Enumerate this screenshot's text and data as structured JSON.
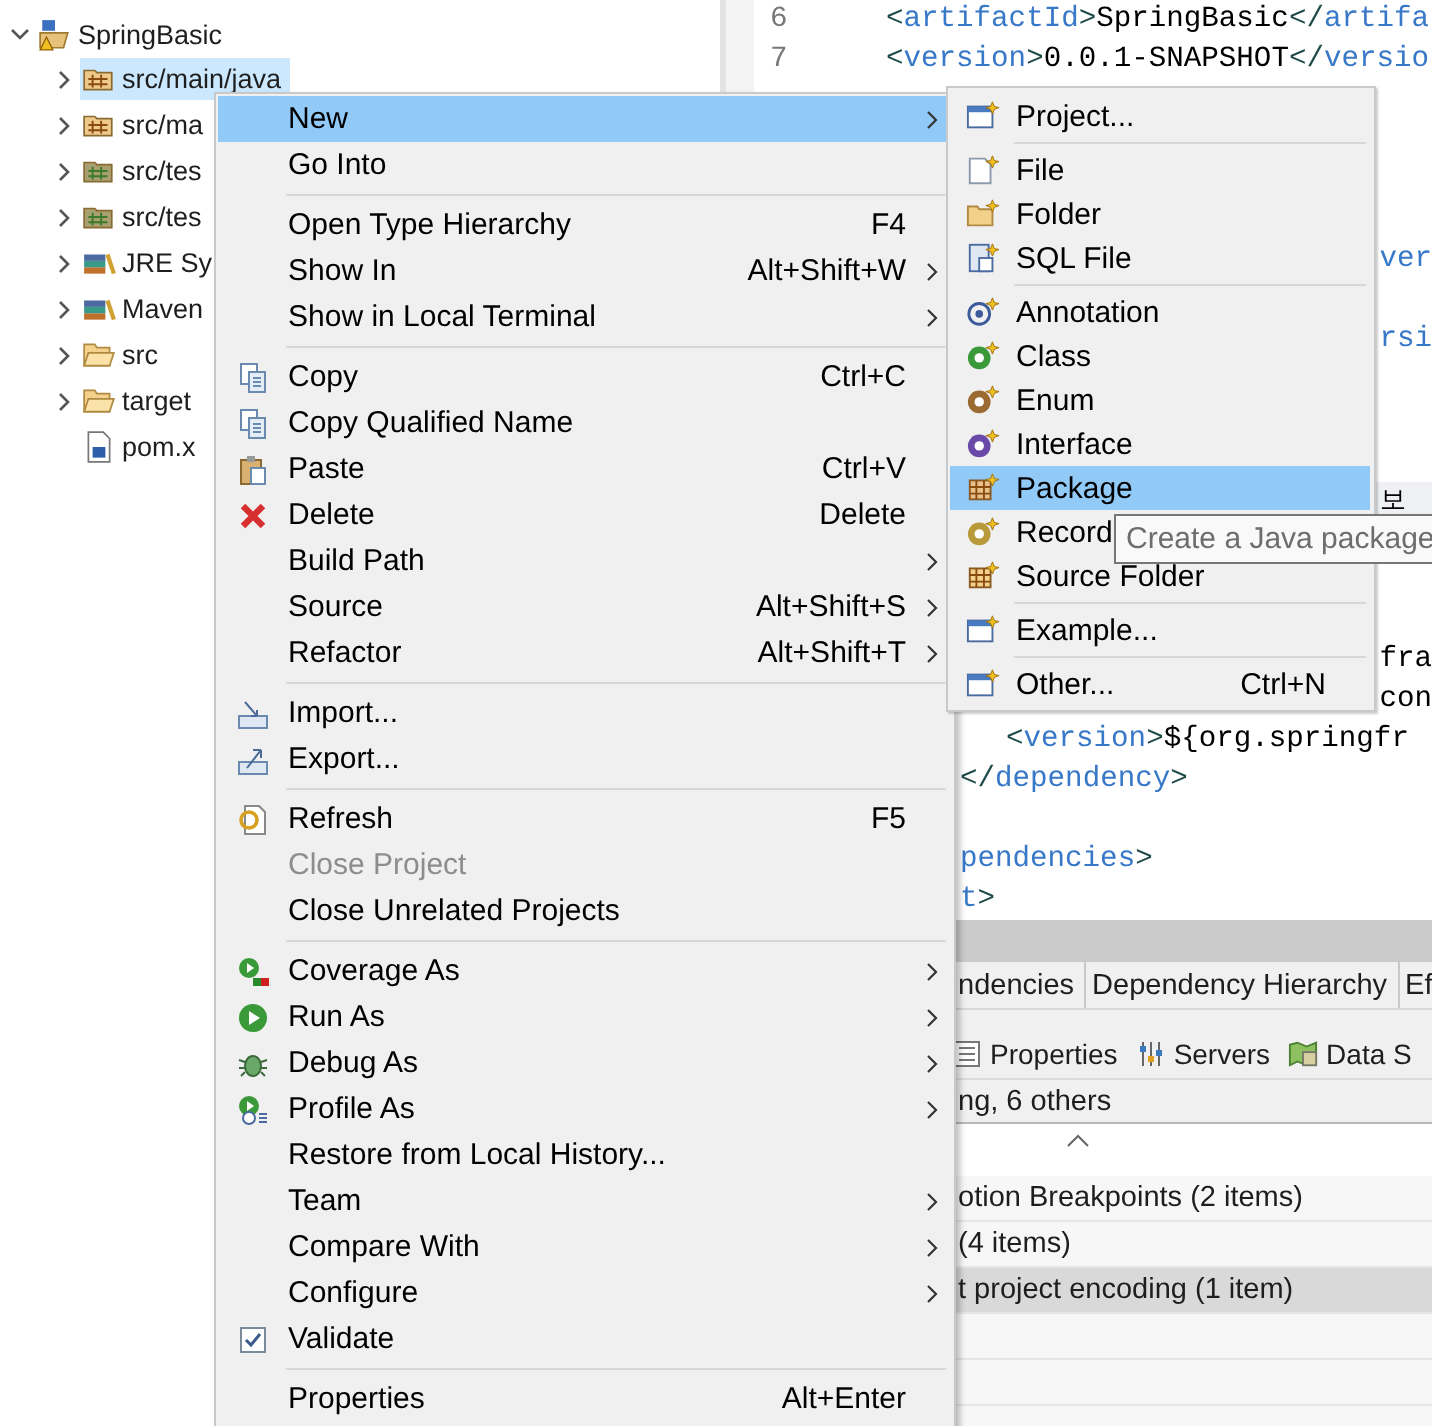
{
  "explorer": {
    "tree": [
      {
        "label": "SpringBasic",
        "kind": "project",
        "expanded": true,
        "selected": false,
        "warning": true,
        "children": [
          {
            "label": "src/main/java",
            "kind": "source-folder",
            "expanded": false,
            "selected": true
          },
          {
            "label": "src/ma",
            "kind": "source-folder",
            "expanded": false,
            "selected": false
          },
          {
            "label": "src/tes",
            "kind": "test-folder",
            "expanded": false,
            "selected": false
          },
          {
            "label": "src/tes",
            "kind": "test-folder",
            "expanded": false,
            "selected": false
          },
          {
            "label": "JRE Sy",
            "kind": "library",
            "expanded": false,
            "selected": false
          },
          {
            "label": "Maven",
            "kind": "library",
            "expanded": false,
            "selected": false
          },
          {
            "label": "src",
            "kind": "folder",
            "expanded": false,
            "selected": false
          },
          {
            "label": "target",
            "kind": "folder",
            "expanded": false,
            "selected": false
          },
          {
            "label": "pom.x",
            "kind": "file",
            "selected": false
          }
        ]
      }
    ]
  },
  "editor": {
    "lines": [
      {
        "number": "6",
        "kind": "code",
        "text": "<artifactId>SpringBasic</artifa"
      },
      {
        "number": "7",
        "kind": "code",
        "text": "<version>0.0.1-SNAPSHOT</versio"
      },
      {
        "kind": "blank"
      },
      {
        "kind": "blank"
      },
      {
        "kind": "blank"
      },
      {
        "kind": "blank"
      },
      {
        "kind": "fragment-right",
        "text": "ver",
        "in_tag": true
      },
      {
        "kind": "blank"
      },
      {
        "kind": "fragment-right",
        "text": "rsi",
        "in_tag": true
      },
      {
        "kind": "blank"
      },
      {
        "kind": "blank"
      },
      {
        "kind": "blank"
      },
      {
        "kind": "hint",
        "text": "보"
      },
      {
        "kind": "blank"
      },
      {
        "kind": "blank"
      },
      {
        "kind": "blank"
      },
      {
        "kind": "fragment-right",
        "text": "fra",
        "in_tag": false
      },
      {
        "kind": "fragment-right",
        "text": "con",
        "in_tag": false
      },
      {
        "kind": "fragment-indented",
        "text": "<version>${org.springfr"
      },
      {
        "kind": "fragment-left",
        "text": "</dependency>"
      },
      {
        "kind": "blank"
      },
      {
        "kind": "fragment-left",
        "text": "pendencies>",
        "in_tag": true
      },
      {
        "kind": "fragment-left",
        "text": "t>",
        "in_tag": true
      }
    ]
  },
  "bottom_panel": {
    "editor_tabs": [
      {
        "label": "ndencies",
        "selected": false
      },
      {
        "label": "Dependency Hierarchy",
        "selected": false
      },
      {
        "label": "Ef",
        "selected": false
      }
    ],
    "view_tabs": [
      {
        "label": "Properties"
      },
      {
        "label": "Servers"
      },
      {
        "label": "Data S"
      }
    ],
    "summary": "ng, 6 others",
    "rows": [
      {
        "text": "otion Breakpoints (2 items)",
        "selected": false
      },
      {
        "text": "(4 items)",
        "selected": false
      },
      {
        "text": "t project encoding (1 item)",
        "selected": true
      }
    ]
  },
  "context_menu": {
    "groups": [
      {
        "items": [
          {
            "label": "New",
            "submenu": true,
            "selected": true,
            "disabled": false
          },
          {
            "label": "Go Into",
            "submenu": false,
            "selected": false,
            "disabled": false
          }
        ]
      },
      {
        "items": [
          {
            "label": "Open Type Hierarchy",
            "shortcut": "F4",
            "submenu": false,
            "selected": false,
            "disabled": false
          },
          {
            "label": "Show In",
            "shortcut": "Alt+Shift+W",
            "submenu": true,
            "selected": false,
            "disabled": false
          },
          {
            "label": "Show in Local Terminal",
            "submenu": true,
            "selected": false,
            "disabled": false
          }
        ]
      },
      {
        "items": [
          {
            "label": "Copy",
            "shortcut": "Ctrl+C",
            "submenu": false,
            "selected": false,
            "disabled": false
          },
          {
            "label": "Copy Qualified Name",
            "submenu": false,
            "selected": false,
            "disabled": false
          },
          {
            "label": "Paste",
            "shortcut": "Ctrl+V",
            "submenu": false,
            "selected": false,
            "disabled": false
          },
          {
            "label": "Delete",
            "shortcut": "Delete",
            "submenu": false,
            "selected": false,
            "disabled": false
          },
          {
            "label": "Build Path",
            "submenu": true,
            "selected": false,
            "disabled": false
          },
          {
            "label": "Source",
            "shortcut": "Alt+Shift+S",
            "submenu": true,
            "selected": false,
            "disabled": false
          },
          {
            "label": "Refactor",
            "shortcut": "Alt+Shift+T",
            "submenu": true,
            "selected": false,
            "disabled": false
          }
        ]
      },
      {
        "items": [
          {
            "label": "Import...",
            "submenu": false,
            "selected": false,
            "disabled": false
          },
          {
            "label": "Export...",
            "submenu": false,
            "selected": false,
            "disabled": false
          }
        ]
      },
      {
        "items": [
          {
            "label": "Refresh",
            "shortcut": "F5",
            "submenu": false,
            "selected": false,
            "disabled": false
          },
          {
            "label": "Close Project",
            "submenu": false,
            "selected": false,
            "disabled": true
          },
          {
            "label": "Close Unrelated Projects",
            "submenu": false,
            "selected": false,
            "disabled": false
          }
        ]
      },
      {
        "items": [
          {
            "label": "Coverage As",
            "submenu": true,
            "selected": false,
            "disabled": false
          },
          {
            "label": "Run As",
            "submenu": true,
            "selected": false,
            "disabled": false
          },
          {
            "label": "Debug As",
            "submenu": true,
            "selected": false,
            "disabled": false
          },
          {
            "label": "Profile As",
            "submenu": true,
            "selected": false,
            "disabled": false
          },
          {
            "label": "Restore from Local History...",
            "submenu": false,
            "selected": false,
            "disabled": false
          },
          {
            "label": "Team",
            "submenu": true,
            "selected": false,
            "disabled": false
          },
          {
            "label": "Compare With",
            "submenu": true,
            "selected": false,
            "disabled": false
          },
          {
            "label": "Configure",
            "submenu": true,
            "selected": false,
            "disabled": false
          },
          {
            "label": "Validate",
            "submenu": false,
            "selected": false,
            "disabled": false
          }
        ]
      },
      {
        "items": [
          {
            "label": "Properties",
            "shortcut": "Alt+Enter",
            "submenu": false,
            "selected": false,
            "disabled": false
          }
        ]
      }
    ]
  },
  "submenu": {
    "groups": [
      {
        "items": [
          {
            "label": "Project...",
            "selected": false
          }
        ]
      },
      {
        "items": [
          {
            "label": "File",
            "selected": false
          },
          {
            "label": "Folder",
            "selected": false
          },
          {
            "label": "SQL File",
            "selected": false
          }
        ]
      },
      {
        "items": [
          {
            "label": "Annotation",
            "selected": false
          },
          {
            "label": "Class",
            "selected": false
          },
          {
            "label": "Enum",
            "selected": false
          },
          {
            "label": "Interface",
            "selected": false
          },
          {
            "label": "Package",
            "selected": true
          },
          {
            "label": "Record",
            "selected": false
          },
          {
            "label": "Source Folder",
            "selected": false
          }
        ]
      },
      {
        "items": [
          {
            "label": "Example...",
            "selected": false
          }
        ]
      },
      {
        "items": [
          {
            "label": "Other...",
            "shortcut": "Ctrl+N",
            "selected": false
          }
        ]
      }
    ]
  },
  "tooltip": {
    "text": "Create a Java package"
  }
}
